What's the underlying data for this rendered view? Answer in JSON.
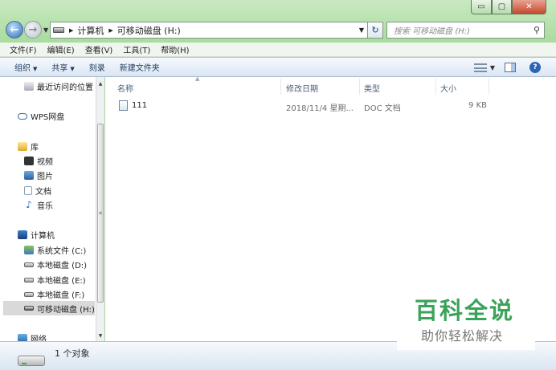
{
  "window": {
    "minimize_symbol": "▭",
    "maximize_symbol": "▢",
    "close_symbol": "✕"
  },
  "address": {
    "crumbs": [
      "计算机",
      "可移动磁盘 (H:)"
    ],
    "search_placeholder": "搜索 可移动磁盘 (H:)"
  },
  "menu": [
    "文件(F)",
    "编辑(E)",
    "查看(V)",
    "工具(T)",
    "帮助(H)"
  ],
  "toolbar": {
    "organize": "组织",
    "share": "共享",
    "burn": "刻录",
    "new_folder": "新建文件夹"
  },
  "nav": {
    "recent": "最近访问的位置",
    "wps": "WPS网盘",
    "library": "库",
    "videos": "视频",
    "pictures": "图片",
    "documents": "文档",
    "music": "音乐",
    "computer": "计算机",
    "drive_c": "系统文件 (C:)",
    "drive_d": "本地磁盘 (D:)",
    "drive_e": "本地磁盘 (E:)",
    "drive_f": "本地磁盘 (F:)",
    "drive_h": "可移动磁盘 (H:)",
    "network": "网络"
  },
  "columns": {
    "name": "名称",
    "modified": "修改日期",
    "type": "类型",
    "size": "大小"
  },
  "files": [
    {
      "name": "111",
      "modified": "2018/11/4 星期...",
      "type": "DOC 文档",
      "size": "9 KB"
    }
  ],
  "status": {
    "count": "1 个对象"
  },
  "watermark": {
    "title": "百科全说",
    "subtitle": "助你轻松解决"
  }
}
